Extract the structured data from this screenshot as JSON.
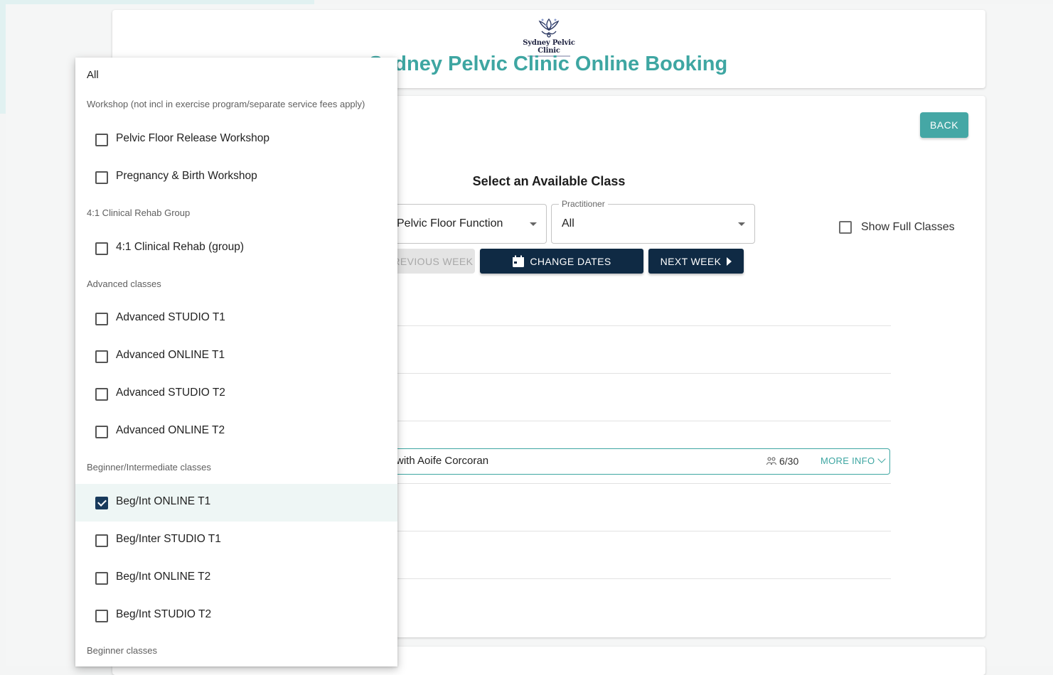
{
  "header": {
    "logo_text": "Sydney Pelvic Clinic",
    "title": "Sydney Pelvic Clinic Online Booking"
  },
  "back_label": "BACK",
  "section_title": "Select an Available Class",
  "filters": {
    "service_value": "Pelvic Floor Function",
    "practitioner_label": "Practitioner",
    "practitioner_value": "All",
    "show_full_label": "Show Full Classes"
  },
  "nav": {
    "prev_label": "PREVIOUS WEEK",
    "change_label": "CHANGE DATES",
    "next_label": "NEXT WEEK"
  },
  "class_row": {
    "teacher": "with Aoife Corcoran",
    "capacity": "6/30",
    "more_label": "MORE INFO"
  },
  "menu": {
    "all_label": "All",
    "groups": [
      {
        "header": "Workshop (not incl in exercise program/separate service fees apply)"
      },
      {
        "header": "4:1 Clinical Rehab Group"
      },
      {
        "header": "Advanced classes"
      },
      {
        "header": "Beginner/Intermediate classes"
      },
      {
        "header": "Beginner classes"
      }
    ],
    "options": [
      {
        "label": "Pelvic Floor Release Workshop",
        "checked": false
      },
      {
        "label": "Pregnancy & Birth Workshop",
        "checked": false
      },
      {
        "label": "4:1 Clinical Rehab (group)",
        "checked": false
      },
      {
        "label": "Advanced STUDIO T1",
        "checked": false
      },
      {
        "label": "Advanced ONLINE T1",
        "checked": false
      },
      {
        "label": "Advanced STUDIO T2",
        "checked": false
      },
      {
        "label": "Advanced ONLINE T2",
        "checked": false
      },
      {
        "label": "Beg/Int ONLINE T1",
        "checked": true
      },
      {
        "label": "Beg/Inter STUDIO T1",
        "checked": false
      },
      {
        "label": "Beg/Int ONLINE T2",
        "checked": false
      },
      {
        "label": "Beg/Int STUDIO T2",
        "checked": false
      }
    ]
  },
  "colors": {
    "accent": "#3ea6a2",
    "navy": "#0f2a44"
  }
}
